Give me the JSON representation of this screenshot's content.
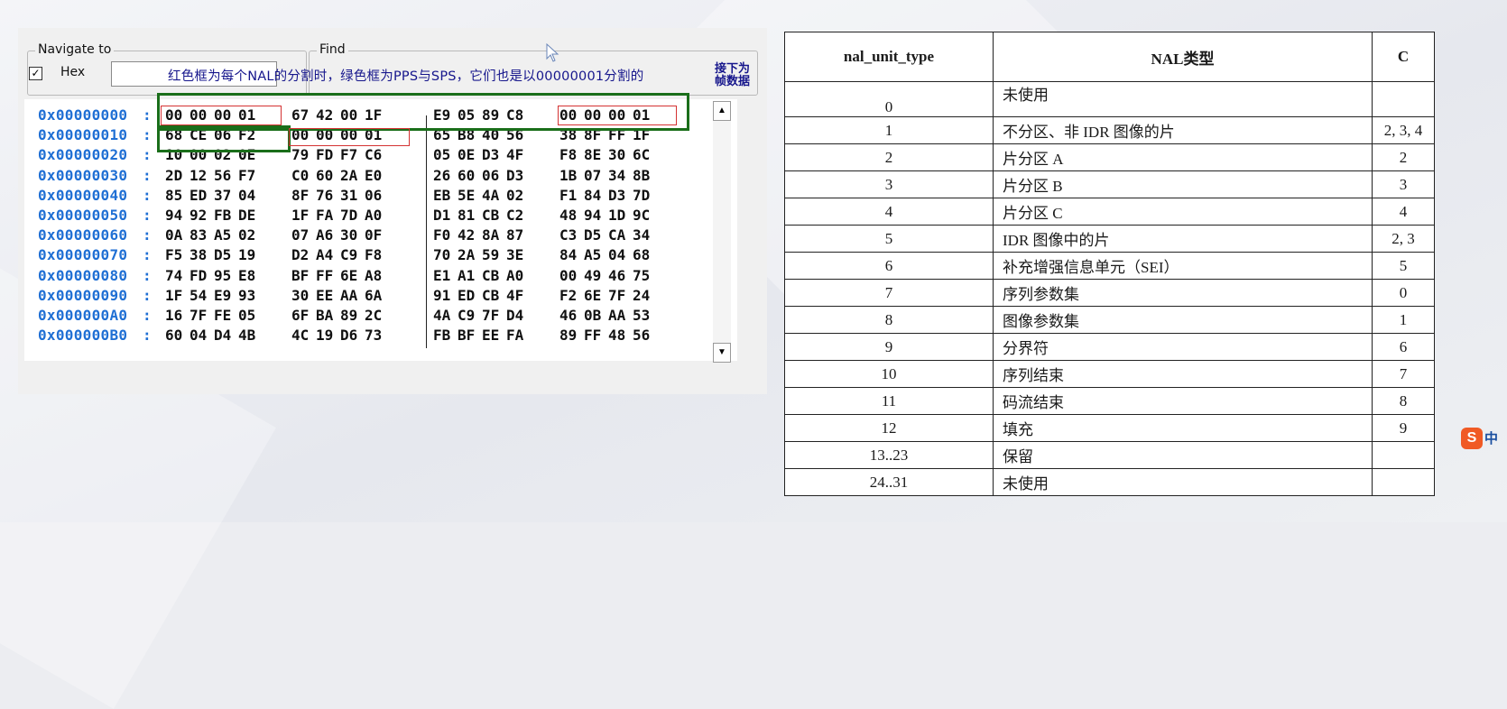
{
  "hex_panel": {
    "navigate_title": "Navigate to",
    "hex_checkbox_label": "Hex",
    "hex_checked": true,
    "find_title": "Find",
    "annotation": "红色框为每个NAL的分割时，绿色框为PPS与SPS，它们也是以00000001分割的",
    "annotation_right": "接下为帧数据",
    "rows": [
      {
        "addr": "0x00000000",
        "bytes": [
          "00",
          "00",
          "00",
          "01",
          "67",
          "42",
          "00",
          "1F",
          "E9",
          "05",
          "89",
          "C8",
          "00",
          "00",
          "00",
          "01"
        ]
      },
      {
        "addr": "0x00000010",
        "bytes": [
          "68",
          "CE",
          "06",
          "F2",
          "00",
          "00",
          "00",
          "01",
          "65",
          "B8",
          "40",
          "56",
          "38",
          "8F",
          "FF",
          "1F"
        ]
      },
      {
        "addr": "0x00000020",
        "bytes": [
          "10",
          "00",
          "02",
          "0E",
          "79",
          "FD",
          "F7",
          "C6",
          "05",
          "0E",
          "D3",
          "4F",
          "F8",
          "8E",
          "30",
          "6C"
        ]
      },
      {
        "addr": "0x00000030",
        "bytes": [
          "2D",
          "12",
          "56",
          "F7",
          "C0",
          "60",
          "2A",
          "E0",
          "26",
          "60",
          "06",
          "D3",
          "1B",
          "07",
          "34",
          "8B"
        ]
      },
      {
        "addr": "0x00000040",
        "bytes": [
          "85",
          "ED",
          "37",
          "04",
          "8F",
          "76",
          "31",
          "06",
          "EB",
          "5E",
          "4A",
          "02",
          "F1",
          "84",
          "D3",
          "7D"
        ]
      },
      {
        "addr": "0x00000050",
        "bytes": [
          "94",
          "92",
          "FB",
          "DE",
          "1F",
          "FA",
          "7D",
          "A0",
          "D1",
          "81",
          "CB",
          "C2",
          "48",
          "94",
          "1D",
          "9C"
        ]
      },
      {
        "addr": "0x00000060",
        "bytes": [
          "0A",
          "83",
          "A5",
          "02",
          "07",
          "A6",
          "30",
          "0F",
          "F0",
          "42",
          "8A",
          "87",
          "C3",
          "D5",
          "CA",
          "34"
        ]
      },
      {
        "addr": "0x00000070",
        "bytes": [
          "F5",
          "38",
          "D5",
          "19",
          "D2",
          "A4",
          "C9",
          "F8",
          "70",
          "2A",
          "59",
          "3E",
          "84",
          "A5",
          "04",
          "68"
        ]
      },
      {
        "addr": "0x00000080",
        "bytes": [
          "74",
          "FD",
          "95",
          "E8",
          "BF",
          "FF",
          "6E",
          "A8",
          "E1",
          "A1",
          "CB",
          "A0",
          "00",
          "49",
          "46",
          "75"
        ]
      },
      {
        "addr": "0x00000090",
        "bytes": [
          "1F",
          "54",
          "E9",
          "93",
          "30",
          "EE",
          "AA",
          "6A",
          "91",
          "ED",
          "CB",
          "4F",
          "F2",
          "6E",
          "7F",
          "24"
        ]
      },
      {
        "addr": "0x000000A0",
        "bytes": [
          "16",
          "7F",
          "FE",
          "05",
          "6F",
          "BA",
          "89",
          "2C",
          "4A",
          "C9",
          "7F",
          "D4",
          "46",
          "0B",
          "AA",
          "53"
        ]
      },
      {
        "addr": "0x000000B0",
        "bytes": [
          "60",
          "04",
          "D4",
          "4B",
          "4C",
          "19",
          "D6",
          "73",
          "FB",
          "BF",
          "EE",
          "FA",
          "89",
          "FF",
          "48",
          "56"
        ]
      }
    ],
    "colors": {
      "address": "#1f6fd4",
      "green_box": "#1a6e1a",
      "red_box": "#d43232",
      "annotation": "#16168c"
    }
  },
  "nal_table": {
    "headers": [
      "nal_unit_type",
      "NAL类型",
      "C"
    ],
    "rows": [
      {
        "type": "0",
        "name": "未使用",
        "c": ""
      },
      {
        "type": "1",
        "name": "不分区、非 IDR 图像的片",
        "c": "2, 3, 4"
      },
      {
        "type": "2",
        "name": "片分区 A",
        "c": "2"
      },
      {
        "type": "3",
        "name": "片分区 B",
        "c": "3"
      },
      {
        "type": "4",
        "name": "片分区 C",
        "c": "4"
      },
      {
        "type": "5",
        "name": "IDR 图像中的片",
        "c": "2, 3"
      },
      {
        "type": "6",
        "name": "补充增强信息单元（SEI）",
        "c": "5"
      },
      {
        "type": "7",
        "name": "序列参数集",
        "c": "0"
      },
      {
        "type": "8",
        "name": "图像参数集",
        "c": "1"
      },
      {
        "type": "9",
        "name": "分界符",
        "c": "6"
      },
      {
        "type": "10",
        "name": "序列结束",
        "c": "7"
      },
      {
        "type": "11",
        "name": "码流结束",
        "c": "8"
      },
      {
        "type": "12",
        "name": "填充",
        "c": "9"
      },
      {
        "type": "13..23",
        "name": "保留",
        "c": ""
      },
      {
        "type": "24..31",
        "name": "未使用",
        "c": ""
      }
    ]
  },
  "ime": {
    "icon": "S",
    "label": "中"
  }
}
